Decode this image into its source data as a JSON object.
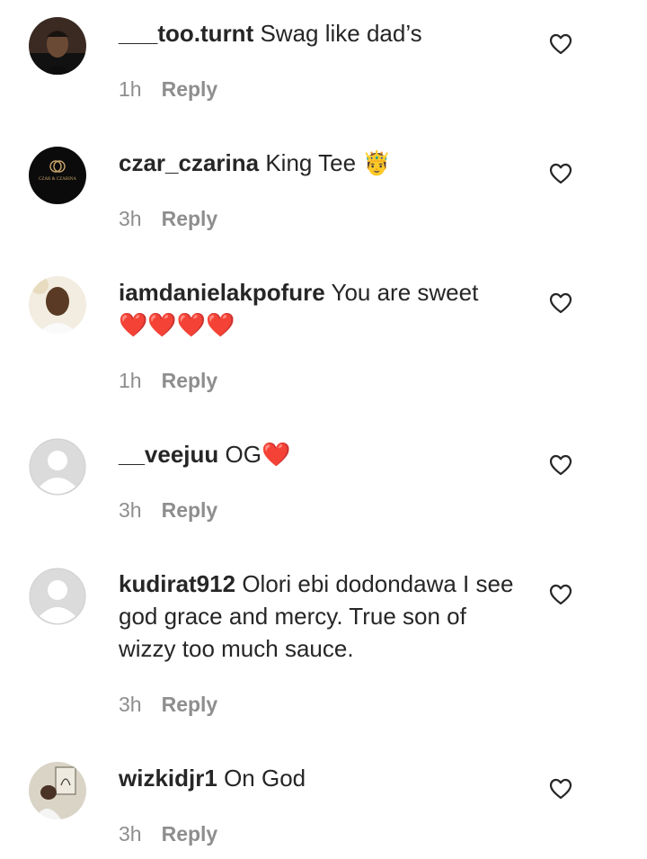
{
  "comments": [
    {
      "username": "___too.turnt",
      "text": "Swag like dad’s",
      "emoji": "",
      "time": "1h",
      "reply_label": "Reply"
    },
    {
      "username": "czar_czarina",
      "text": "King Tee",
      "emoji": "🤴",
      "time": "3h",
      "reply_label": "Reply",
      "avatar_logo_text": "CZAR & CZARINA"
    },
    {
      "username": "iamdanielakpofure",
      "text": "You are sweet",
      "emoji": "❤️❤️❤️❤️",
      "time": "1h",
      "reply_label": "Reply"
    },
    {
      "username": "__veejuu",
      "text": "OG",
      "emoji": "❤️",
      "time": "3h",
      "reply_label": "Reply"
    },
    {
      "username": "kudirat912",
      "text": "Olori ebi dodondawa I see god grace and mercy. True son of wizzy too much sauce.",
      "emoji": "",
      "time": "3h",
      "reply_label": "Reply"
    },
    {
      "username": "wizkidjr1",
      "text": "On God",
      "emoji": "",
      "time": "3h",
      "reply_label": "Reply"
    }
  ],
  "icons": {
    "like": "heart-outline-icon"
  },
  "colors": {
    "text": "#262626",
    "meta": "#8e8e8e",
    "placeholder_avatar": "#dbdbdb",
    "red_heart": "#e0245e"
  }
}
